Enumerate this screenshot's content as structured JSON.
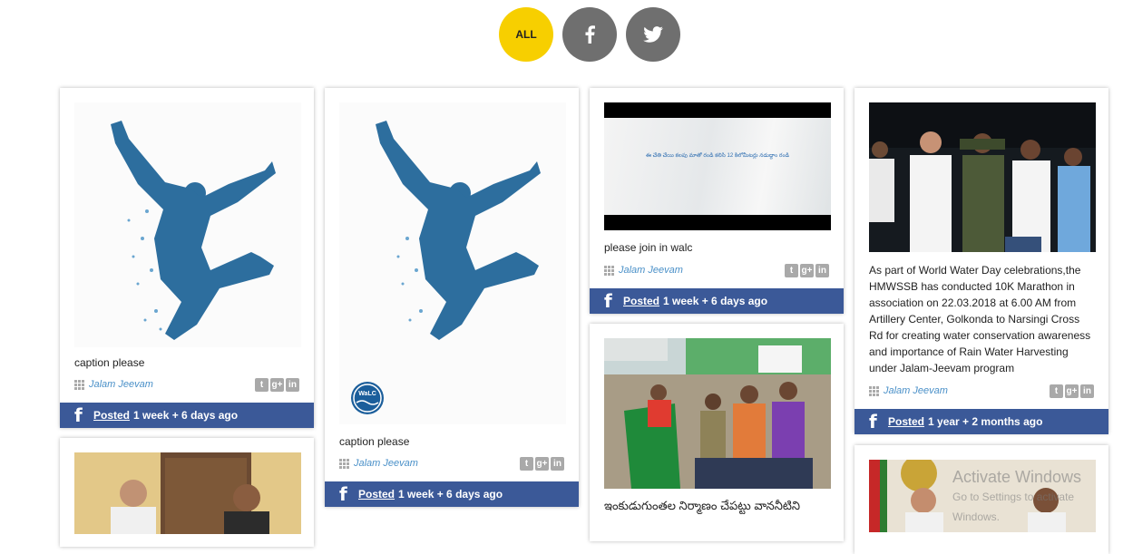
{
  "filters": [
    {
      "label": "ALL",
      "icon": "",
      "active": true
    },
    {
      "label": "",
      "icon": "facebook-icon",
      "active": false
    },
    {
      "label": "",
      "icon": "twitter-icon",
      "active": false
    }
  ],
  "posts": [
    {
      "caption": "caption please",
      "source": "Jalam Jeevam",
      "posted_label": "Posted",
      "time": "1 week + 6 days ago"
    },
    {
      "caption": "caption please",
      "source": "Jalam Jeevam",
      "posted_label": "Posted",
      "time": "1 week + 6 days ago",
      "logo_text": "WaLC"
    },
    {
      "caption": "please join in walc",
      "source": "Jalam Jeevam",
      "posted_label": "Posted",
      "time": "1 week + 6 days ago",
      "image_text": "ఈ చేతి చేయి కలపు మాతో రండి కలిసి 12 కిలోమీటర్లు నడుద్దాం రండి"
    },
    {
      "caption": "As part of World Water Day celebrations,the HMWSSB has conducted 10K Marathon in association on 22.03.2018 at 6.00 AM from Artillery Center, Golkonda to Narsingi Cross Rd for creating water conservation awareness and importance of Rain Water Harvesting under Jalam-Jeevam program",
      "source": "Jalam Jeevam",
      "posted_label": "Posted",
      "time": "1 year + 2 months ago"
    },
    {
      "caption": "ఇంకుడుగుంతల నిర్మాణం చేపట్టు వాననీటిని"
    }
  ],
  "share_icons": [
    "twitter-icon",
    "google-plus-icon",
    "linkedin-icon"
  ],
  "watermark": {
    "title": "Activate Windows",
    "subtitle": "Go to Settings to activate Windows."
  },
  "colors": {
    "active_filter": "#f7cf00",
    "inactive_filter": "#6f6f6f",
    "facebook_bar": "#3b5998",
    "source_link": "#4a90c8"
  }
}
